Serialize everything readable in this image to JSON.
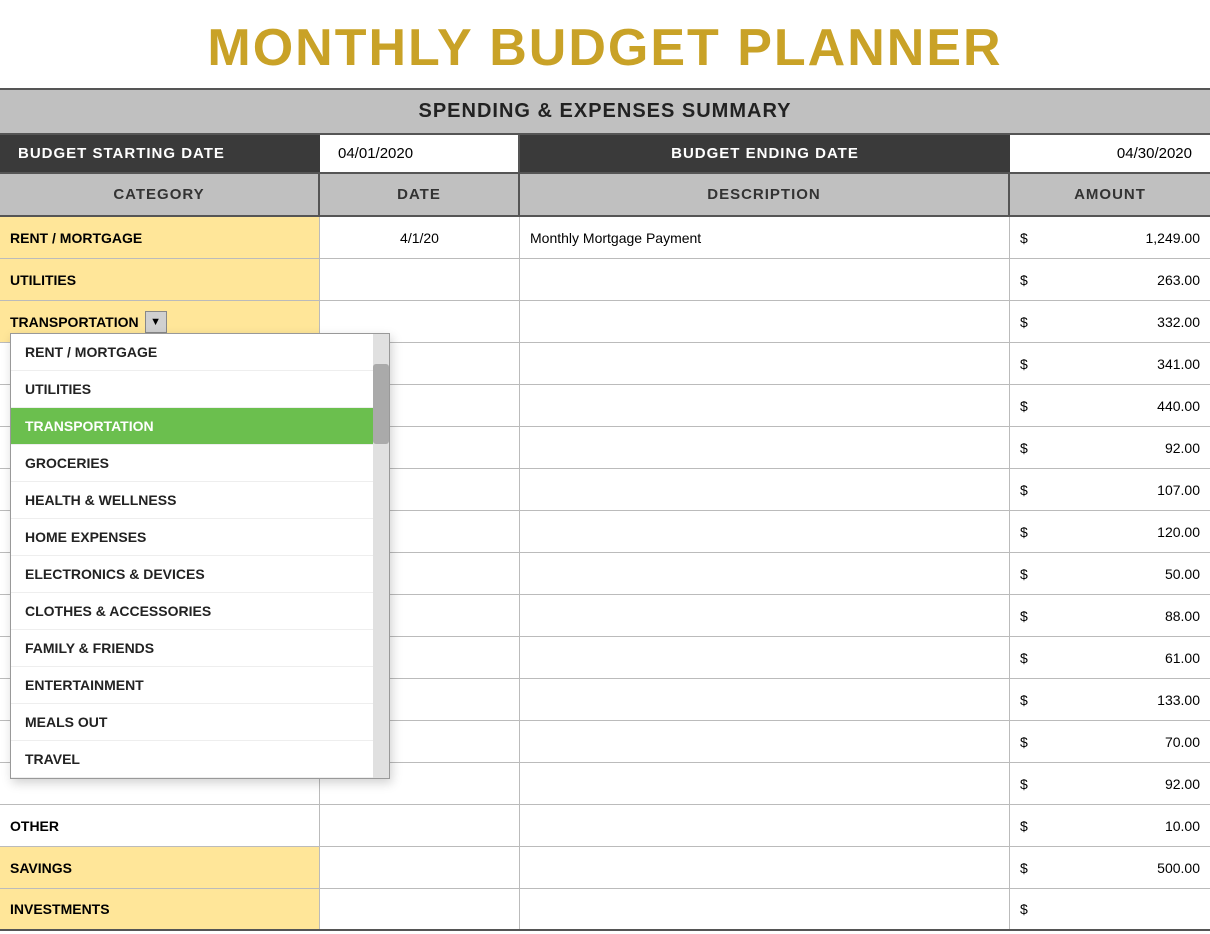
{
  "title": "MONTHLY BUDGET PLANNER",
  "subtitle": "SPENDING & EXPENSES SUMMARY",
  "budget_start_label": "BUDGET STARTING DATE",
  "budget_start_value": "04/01/2020",
  "budget_end_label": "BUDGET ENDING DATE",
  "budget_end_value": "04/30/2020",
  "columns": {
    "category": "CATEGORY",
    "date": "DATE",
    "description": "DESCRIPTION",
    "amount": "AMOUNT"
  },
  "rows": [
    {
      "category": "RENT / MORTGAGE",
      "date": "4/1/20",
      "description": "Monthly Mortgage Payment",
      "amount_dollar": "$",
      "amount_value": "1,249.00",
      "style": "yellow",
      "has_dropdown": false
    },
    {
      "category": "UTILITIES",
      "date": "",
      "description": "",
      "amount_dollar": "$",
      "amount_value": "263.00",
      "style": "yellow",
      "has_dropdown": false
    },
    {
      "category": "TRANSPORTATION",
      "date": "",
      "description": "",
      "amount_dollar": "$",
      "amount_value": "332.00",
      "style": "yellow",
      "has_dropdown": true
    },
    {
      "category": "",
      "date": "",
      "description": "",
      "amount_dollar": "$",
      "amount_value": "341.00",
      "style": "white"
    },
    {
      "category": "",
      "date": "",
      "description": "",
      "amount_dollar": "$",
      "amount_value": "440.00",
      "style": "white"
    },
    {
      "category": "",
      "date": "",
      "description": "",
      "amount_dollar": "$",
      "amount_value": "92.00",
      "style": "white"
    },
    {
      "category": "",
      "date": "",
      "description": "",
      "amount_dollar": "$",
      "amount_value": "107.00",
      "style": "white"
    },
    {
      "category": "",
      "date": "",
      "description": "",
      "amount_dollar": "$",
      "amount_value": "120.00",
      "style": "white"
    },
    {
      "category": "",
      "date": "",
      "description": "",
      "amount_dollar": "$",
      "amount_value": "50.00",
      "style": "white"
    },
    {
      "category": "",
      "date": "",
      "description": "",
      "amount_dollar": "$",
      "amount_value": "88.00",
      "style": "white"
    },
    {
      "category": "",
      "date": "",
      "description": "",
      "amount_dollar": "$",
      "amount_value": "61.00",
      "style": "white"
    },
    {
      "category": "",
      "date": "",
      "description": "",
      "amount_dollar": "$",
      "amount_value": "133.00",
      "style": "white"
    },
    {
      "category": "",
      "date": "",
      "description": "",
      "amount_dollar": "$",
      "amount_value": "70.00",
      "style": "white"
    },
    {
      "category": "",
      "date": "",
      "description": "",
      "amount_dollar": "$",
      "amount_value": "92.00",
      "style": "white"
    },
    {
      "category": "OTHER",
      "date": "",
      "description": "",
      "amount_dollar": "$",
      "amount_value": "10.00",
      "style": "white"
    },
    {
      "category": "SAVINGS",
      "date": "",
      "description": "",
      "amount_dollar": "$",
      "amount_value": "500.00",
      "style": "yellow"
    },
    {
      "category": "INVESTMENTS",
      "date": "",
      "description": "",
      "amount_dollar": "$",
      "amount_value": "",
      "style": "yellow"
    }
  ],
  "dropdown": {
    "items": [
      {
        "label": "RENT / MORTGAGE",
        "selected": false
      },
      {
        "label": "UTILITIES",
        "selected": false
      },
      {
        "label": "TRANSPORTATION",
        "selected": true
      },
      {
        "label": "GROCERIES",
        "selected": false
      },
      {
        "label": "HEALTH & WELLNESS",
        "selected": false
      },
      {
        "label": "HOME EXPENSES",
        "selected": false
      },
      {
        "label": "ELECTRONICS & DEVICES",
        "selected": false
      },
      {
        "label": "CLOTHES & ACCESSORIES",
        "selected": false
      },
      {
        "label": "FAMILY & FRIENDS",
        "selected": false
      },
      {
        "label": "ENTERTAINMENT",
        "selected": false
      },
      {
        "label": "MEALS OUT",
        "selected": false
      },
      {
        "label": "TRAVEL",
        "selected": false
      }
    ]
  }
}
